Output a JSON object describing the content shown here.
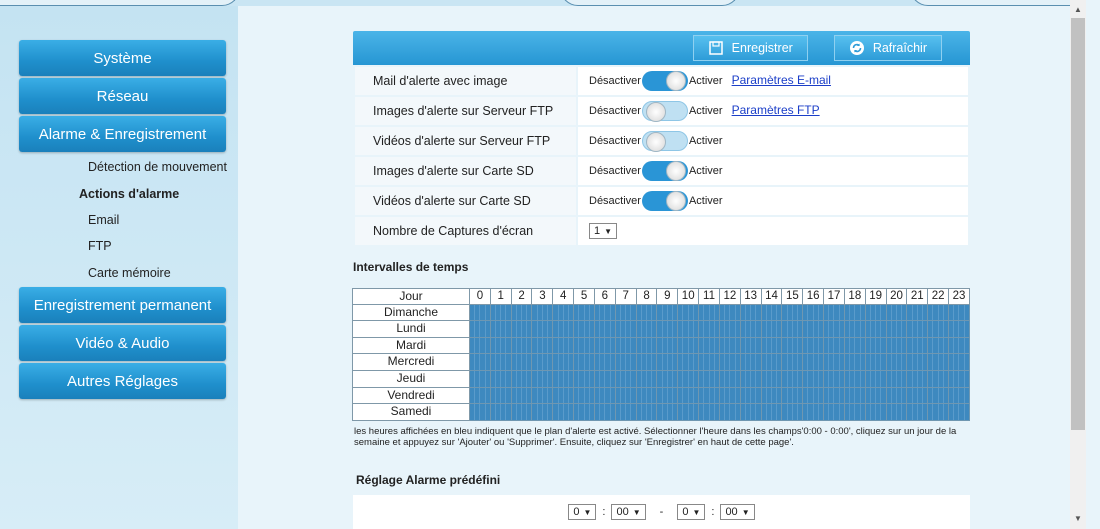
{
  "sidebar": {
    "items": [
      {
        "label": "Système"
      },
      {
        "label": "Réseau"
      },
      {
        "label": "Alarme & Enregistrement"
      },
      {
        "label": "Enregistrement permanent"
      },
      {
        "label": "Vidéo & Audio"
      },
      {
        "label": "Autres Réglages"
      }
    ],
    "subitems": [
      {
        "label": "Détection de mouvement"
      },
      {
        "label": "Actions d'alarme"
      },
      {
        "label": "Email"
      },
      {
        "label": "FTP"
      },
      {
        "label": "Carte mémoire"
      }
    ]
  },
  "toolbar": {
    "save_label": "Enregistrer",
    "refresh_label": "Rafraîchir"
  },
  "settings": {
    "off_label": "Désactiver",
    "on_label": "Activer",
    "rows": [
      {
        "label": "Mail d'alerte avec image",
        "enabled": true,
        "link": "Paramètres E-mail"
      },
      {
        "label": "Images d'alerte sur Serveur FTP",
        "enabled": false,
        "link": "Paramètres FTP"
      },
      {
        "label": "Vidéos d'alerte sur Serveur FTP",
        "enabled": false
      },
      {
        "label": "Images d'alerte sur Carte SD",
        "enabled": true
      },
      {
        "label": "Vidéos d'alerte sur Carte SD",
        "enabled": true
      }
    ],
    "captures_label": "Nombre de Captures d'écran",
    "captures_value": "1"
  },
  "schedule": {
    "title": "Intervalles de temps",
    "day_header": "Jour",
    "hours": [
      "0",
      "1",
      "2",
      "3",
      "4",
      "5",
      "6",
      "7",
      "8",
      "9",
      "10",
      "11",
      "12",
      "13",
      "14",
      "15",
      "16",
      "17",
      "18",
      "19",
      "20",
      "21",
      "22",
      "23"
    ],
    "days": [
      "Dimanche",
      "Lundi",
      "Mardi",
      "Mercredi",
      "Jeudi",
      "Vendredi",
      "Samedi"
    ],
    "active_color": "#3e89bf",
    "note": "les heures affichées en bleu indiquent que le plan d'alerte est activé. Sélectionner l'heure dans les champs'0:00 - 0:00', cliquez sur un jour de la semaine et appuyez sur 'Ajouter' ou 'Supprimer'. Ensuite, cliquez sur 'Enregistrer' en haut de cette page'."
  },
  "preset": {
    "title": "Réglage Alarme prédéfini",
    "start_hour": "0",
    "start_min": "00",
    "separator": "-",
    "end_hour": "0",
    "end_min": "00"
  },
  "colors": {
    "accent": "#2a95d6",
    "background": "#c9e5f3",
    "link": "#1b3ec8"
  }
}
